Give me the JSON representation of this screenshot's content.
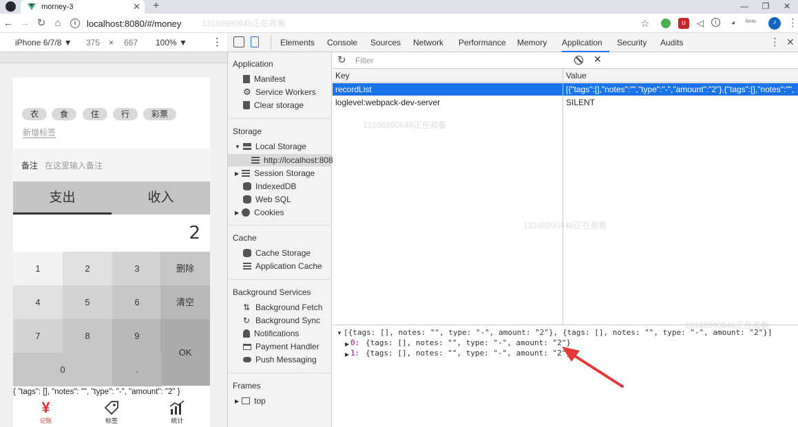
{
  "browser": {
    "tab_title": "morney-3",
    "url": "localhost:8080/#/money",
    "watermark": "13166990648正在观看",
    "fonts_label": "fonts"
  },
  "device_toolbar": {
    "device": "iPhone 6/7/8 ▼",
    "width": "375",
    "times": "×",
    "height": "667",
    "zoom": "100% ▼"
  },
  "app": {
    "tags": [
      "衣",
      "食",
      "住",
      "行",
      "彩票"
    ],
    "new_tag": "新增标签",
    "notes_label": "备注",
    "notes_placeholder": "在这里输入备注",
    "type_expense": "支出",
    "type_income": "收入",
    "output": "2",
    "keys": {
      "k1": "1",
      "k2": "2",
      "k3": "3",
      "del": "删除",
      "k4": "4",
      "k5": "5",
      "k6": "6",
      "clear": "清空",
      "k7": "7",
      "k8": "8",
      "k9": "9",
      "ok": "OK",
      "k0": "0",
      "dot": "."
    },
    "debug_json": "{ \"tags\": [], \"notes\": \"\", \"type\": \"-\", \"amount\": \"2\" }",
    "nav": [
      "记账",
      "标签",
      "统计"
    ]
  },
  "devtools": {
    "tabs": [
      "Elements",
      "Console",
      "Sources",
      "Network",
      "Performance",
      "Memory",
      "Application",
      "Security",
      "Audits"
    ],
    "active_tab": "Application",
    "sidebar": {
      "application_header": "Application",
      "manifest": "Manifest",
      "service_workers": "Service Workers",
      "clear_storage": "Clear storage",
      "storage_header": "Storage",
      "local_storage": "Local Storage",
      "local_origin": "http://localhost:808",
      "session_storage": "Session Storage",
      "indexeddb": "IndexedDB",
      "websql": "Web SQL",
      "cookies": "Cookies",
      "cache_header": "Cache",
      "cache_storage": "Cache Storage",
      "app_cache": "Application Cache",
      "bg_header": "Background Services",
      "bg_fetch": "Background Fetch",
      "bg_sync": "Background Sync",
      "notifications": "Notifications",
      "payment_handler": "Payment Handler",
      "push_messaging": "Push Messaging",
      "frames_header": "Frames",
      "top": "top"
    },
    "filter_placeholder": "Filter",
    "table": {
      "col_key": "Key",
      "col_value": "Value",
      "rows": [
        {
          "key": "recordList",
          "value": "[{\"tags\":[],\"notes\":\"\",\"type\":\"-\",\"amount\":\"2\"},{\"tags\":[],\"notes\":\"\",..."
        },
        {
          "key": "loglevel:webpack-dev-server",
          "value": "SILENT"
        }
      ]
    },
    "preview": {
      "line0": "[{tags: [], notes: \"\", type: \"-\", amount: \"2\"}, {tags: [], notes: \"\", type: \"-\", amount: \"2\"}]",
      "item0_index": "0:",
      "item0": "{tags: [], notes: \"\", type: \"-\", amount: \"2\"}",
      "item1_index": "1:",
      "item1": "{tags: [], notes: \"\", type: \"-\", amount: \"2\"}"
    }
  }
}
